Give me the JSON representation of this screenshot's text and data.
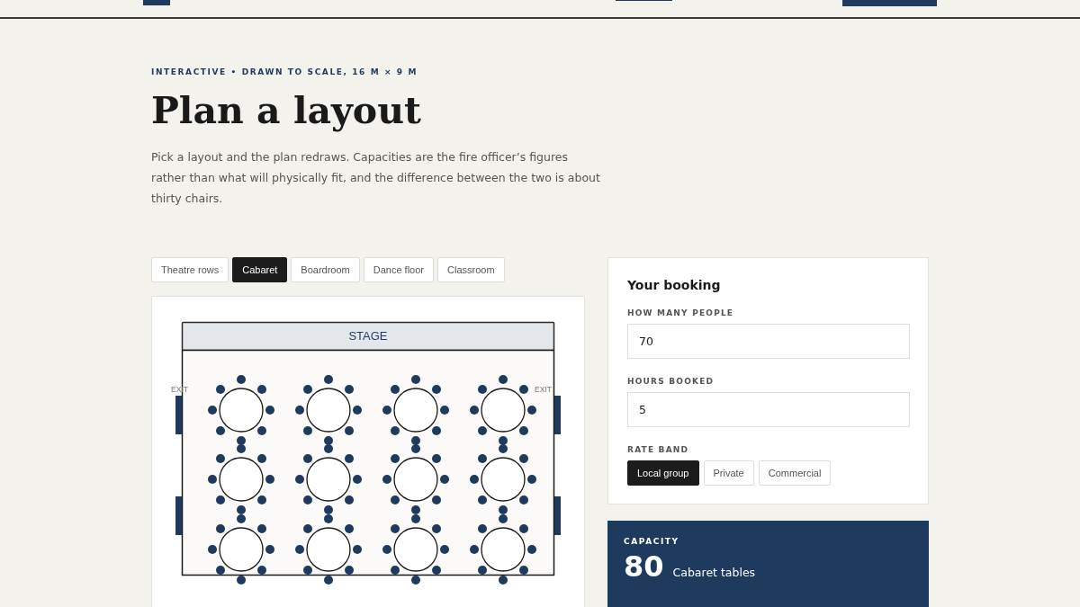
{
  "eyebrow": "INTERACTIVE • DRAWN TO SCALE, 16 M × 9 M",
  "title": "Plan a layout",
  "intro": "Pick a layout and the plan redraws. Capacities are the fire officer’s figures rather than what will physically fit, and the difference between the two is about thirty chairs.",
  "layouts": [
    {
      "label": "Theatre rows",
      "selected": false
    },
    {
      "label": "Cabaret",
      "selected": true
    },
    {
      "label": "Boardroom",
      "selected": false
    },
    {
      "label": "Dance floor",
      "selected": false
    },
    {
      "label": "Classroom",
      "selected": false
    }
  ],
  "plan": {
    "stage_label": "STAGE",
    "exit_left": "EXIT",
    "exit_right": "EXIT"
  },
  "booking": {
    "title": "Your booking",
    "fields": [
      {
        "label": "HOW MANY PEOPLE",
        "value": "70"
      },
      {
        "label": "HOURS BOOKED",
        "value": "5"
      }
    ],
    "rate_band": {
      "label": "RATE BAND",
      "options": [
        {
          "label": "Local group",
          "selected": true
        },
        {
          "label": "Private",
          "selected": false
        },
        {
          "label": "Commercial",
          "selected": false
        }
      ]
    }
  },
  "capacity": {
    "label": "CAPACITY",
    "value": "80",
    "note": "Cabaret tables"
  }
}
